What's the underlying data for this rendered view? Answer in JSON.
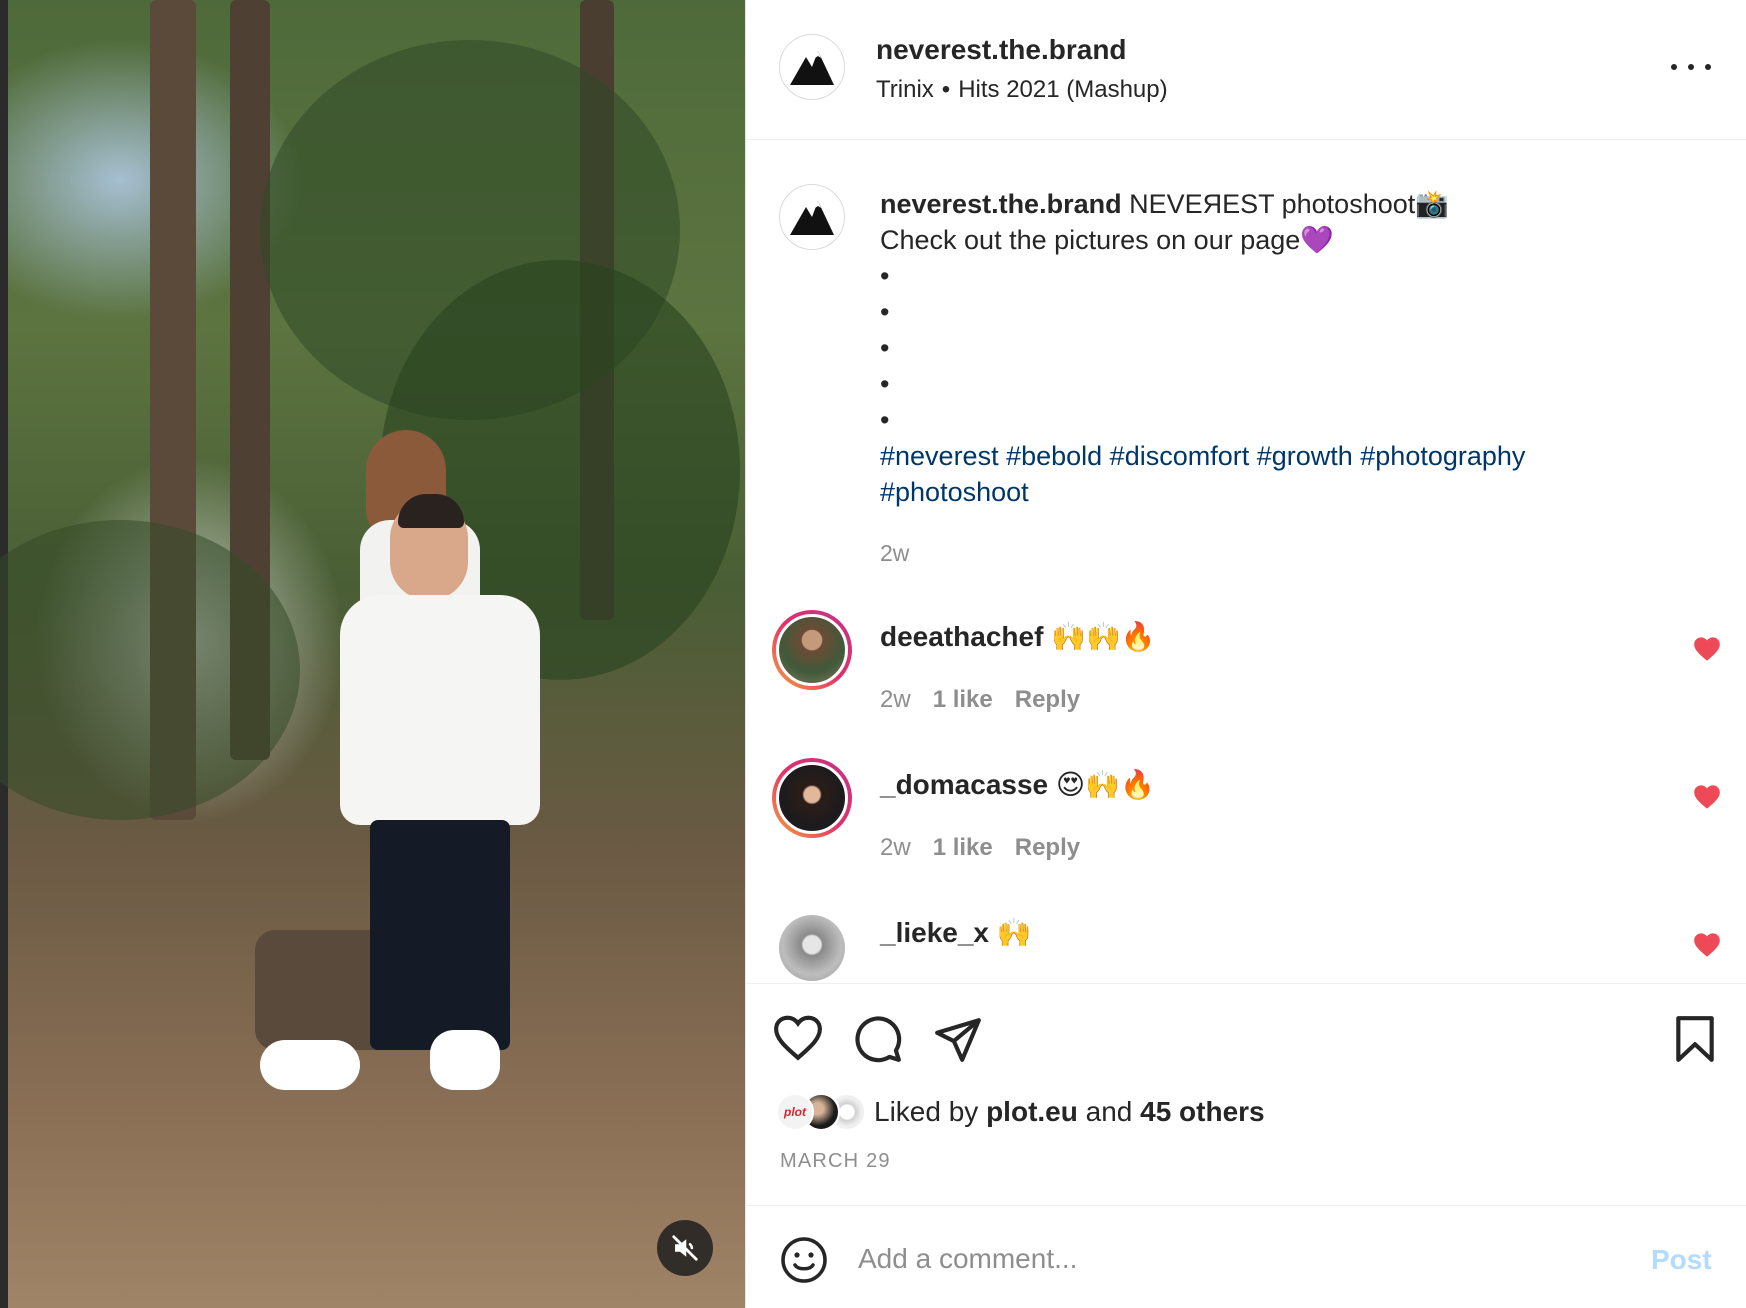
{
  "post": {
    "username": "neverest.the.brand",
    "audio": {
      "artist": "Trinix",
      "separator": "•",
      "track": "Hits 2021 (Mashup)"
    },
    "caption": {
      "username": "neverest.the.brand",
      "line1": " NEVEЯEST photoshoot📸",
      "line2": "Check out the pictures on our page💜",
      "bullets": [
        "•",
        "•",
        "•",
        "•",
        "•"
      ],
      "hashtags_line1": "#neverest #bebold #discomfort #growth #photography",
      "hashtags_line2": "#photoshoot",
      "time": "2w"
    },
    "comments": [
      {
        "username": "deeathachef",
        "text": " 🙌🙌🔥",
        "time": "2w",
        "likes": "1 like",
        "reply": "Reply",
        "liked": true
      },
      {
        "username": "_domacasse",
        "text": " 😍🙌🔥",
        "time": "2w",
        "likes": "1 like",
        "reply": "Reply",
        "liked": true
      },
      {
        "username": "_lieke_x",
        "text": " 🙌",
        "liked": true
      }
    ],
    "likes": {
      "prefix": "Liked by ",
      "user": "plot.eu",
      "middle": " and ",
      "others": "45 others",
      "first_avatar_label": "plot"
    },
    "date": "MARCH 29",
    "composer": {
      "placeholder": "Add a comment...",
      "post_label": "Post"
    }
  },
  "icons": {
    "header_avatar": "mountain-logo-icon",
    "more": "more-horizontal-icon",
    "like": "heart-outline-icon",
    "comment": "speech-bubble-icon",
    "share": "paper-plane-icon",
    "save": "bookmark-icon",
    "emoji": "smiley-icon",
    "mute": "speaker-muted-icon",
    "comment_like": "heart-filled-icon"
  },
  "colors": {
    "heart": "#ed4956",
    "hashtag": "#00376b",
    "post_disabled": "#b3dbff",
    "muted_text": "#8e8e8e"
  }
}
